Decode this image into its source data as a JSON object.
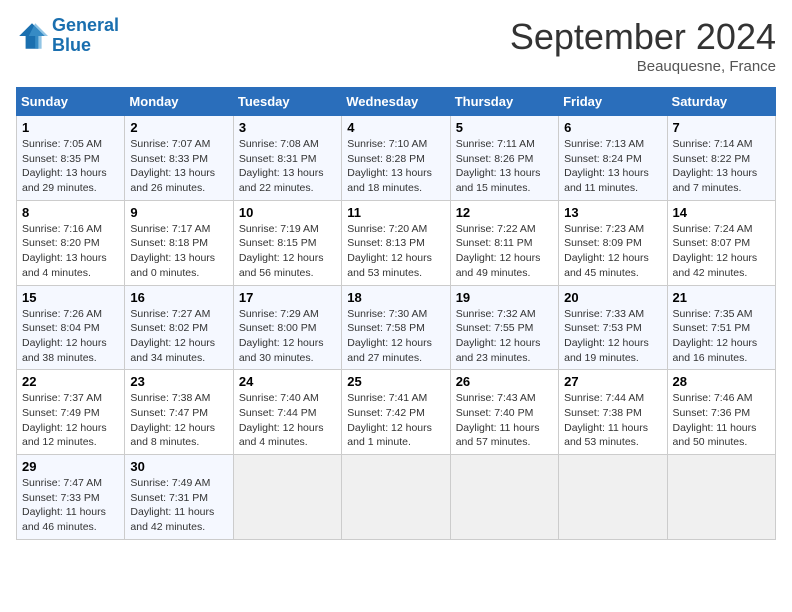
{
  "header": {
    "logo_line1": "General",
    "logo_line2": "Blue",
    "month": "September 2024",
    "location": "Beauquesne, France"
  },
  "weekdays": [
    "Sunday",
    "Monday",
    "Tuesday",
    "Wednesday",
    "Thursday",
    "Friday",
    "Saturday"
  ],
  "weeks": [
    [
      {
        "day": "1",
        "detail": "Sunrise: 7:05 AM\nSunset: 8:35 PM\nDaylight: 13 hours\nand 29 minutes."
      },
      {
        "day": "2",
        "detail": "Sunrise: 7:07 AM\nSunset: 8:33 PM\nDaylight: 13 hours\nand 26 minutes."
      },
      {
        "day": "3",
        "detail": "Sunrise: 7:08 AM\nSunset: 8:31 PM\nDaylight: 13 hours\nand 22 minutes."
      },
      {
        "day": "4",
        "detail": "Sunrise: 7:10 AM\nSunset: 8:28 PM\nDaylight: 13 hours\nand 18 minutes."
      },
      {
        "day": "5",
        "detail": "Sunrise: 7:11 AM\nSunset: 8:26 PM\nDaylight: 13 hours\nand 15 minutes."
      },
      {
        "day": "6",
        "detail": "Sunrise: 7:13 AM\nSunset: 8:24 PM\nDaylight: 13 hours\nand 11 minutes."
      },
      {
        "day": "7",
        "detail": "Sunrise: 7:14 AM\nSunset: 8:22 PM\nDaylight: 13 hours\nand 7 minutes."
      }
    ],
    [
      {
        "day": "8",
        "detail": "Sunrise: 7:16 AM\nSunset: 8:20 PM\nDaylight: 13 hours\nand 4 minutes."
      },
      {
        "day": "9",
        "detail": "Sunrise: 7:17 AM\nSunset: 8:18 PM\nDaylight: 13 hours\nand 0 minutes."
      },
      {
        "day": "10",
        "detail": "Sunrise: 7:19 AM\nSunset: 8:15 PM\nDaylight: 12 hours\nand 56 minutes."
      },
      {
        "day": "11",
        "detail": "Sunrise: 7:20 AM\nSunset: 8:13 PM\nDaylight: 12 hours\nand 53 minutes."
      },
      {
        "day": "12",
        "detail": "Sunrise: 7:22 AM\nSunset: 8:11 PM\nDaylight: 12 hours\nand 49 minutes."
      },
      {
        "day": "13",
        "detail": "Sunrise: 7:23 AM\nSunset: 8:09 PM\nDaylight: 12 hours\nand 45 minutes."
      },
      {
        "day": "14",
        "detail": "Sunrise: 7:24 AM\nSunset: 8:07 PM\nDaylight: 12 hours\nand 42 minutes."
      }
    ],
    [
      {
        "day": "15",
        "detail": "Sunrise: 7:26 AM\nSunset: 8:04 PM\nDaylight: 12 hours\nand 38 minutes."
      },
      {
        "day": "16",
        "detail": "Sunrise: 7:27 AM\nSunset: 8:02 PM\nDaylight: 12 hours\nand 34 minutes."
      },
      {
        "day": "17",
        "detail": "Sunrise: 7:29 AM\nSunset: 8:00 PM\nDaylight: 12 hours\nand 30 minutes."
      },
      {
        "day": "18",
        "detail": "Sunrise: 7:30 AM\nSunset: 7:58 PM\nDaylight: 12 hours\nand 27 minutes."
      },
      {
        "day": "19",
        "detail": "Sunrise: 7:32 AM\nSunset: 7:55 PM\nDaylight: 12 hours\nand 23 minutes."
      },
      {
        "day": "20",
        "detail": "Sunrise: 7:33 AM\nSunset: 7:53 PM\nDaylight: 12 hours\nand 19 minutes."
      },
      {
        "day": "21",
        "detail": "Sunrise: 7:35 AM\nSunset: 7:51 PM\nDaylight: 12 hours\nand 16 minutes."
      }
    ],
    [
      {
        "day": "22",
        "detail": "Sunrise: 7:37 AM\nSunset: 7:49 PM\nDaylight: 12 hours\nand 12 minutes."
      },
      {
        "day": "23",
        "detail": "Sunrise: 7:38 AM\nSunset: 7:47 PM\nDaylight: 12 hours\nand 8 minutes."
      },
      {
        "day": "24",
        "detail": "Sunrise: 7:40 AM\nSunset: 7:44 PM\nDaylight: 12 hours\nand 4 minutes."
      },
      {
        "day": "25",
        "detail": "Sunrise: 7:41 AM\nSunset: 7:42 PM\nDaylight: 12 hours\nand 1 minute."
      },
      {
        "day": "26",
        "detail": "Sunrise: 7:43 AM\nSunset: 7:40 PM\nDaylight: 11 hours\nand 57 minutes."
      },
      {
        "day": "27",
        "detail": "Sunrise: 7:44 AM\nSunset: 7:38 PM\nDaylight: 11 hours\nand 53 minutes."
      },
      {
        "day": "28",
        "detail": "Sunrise: 7:46 AM\nSunset: 7:36 PM\nDaylight: 11 hours\nand 50 minutes."
      }
    ],
    [
      {
        "day": "29",
        "detail": "Sunrise: 7:47 AM\nSunset: 7:33 PM\nDaylight: 11 hours\nand 46 minutes."
      },
      {
        "day": "30",
        "detail": "Sunrise: 7:49 AM\nSunset: 7:31 PM\nDaylight: 11 hours\nand 42 minutes."
      },
      null,
      null,
      null,
      null,
      null
    ]
  ]
}
